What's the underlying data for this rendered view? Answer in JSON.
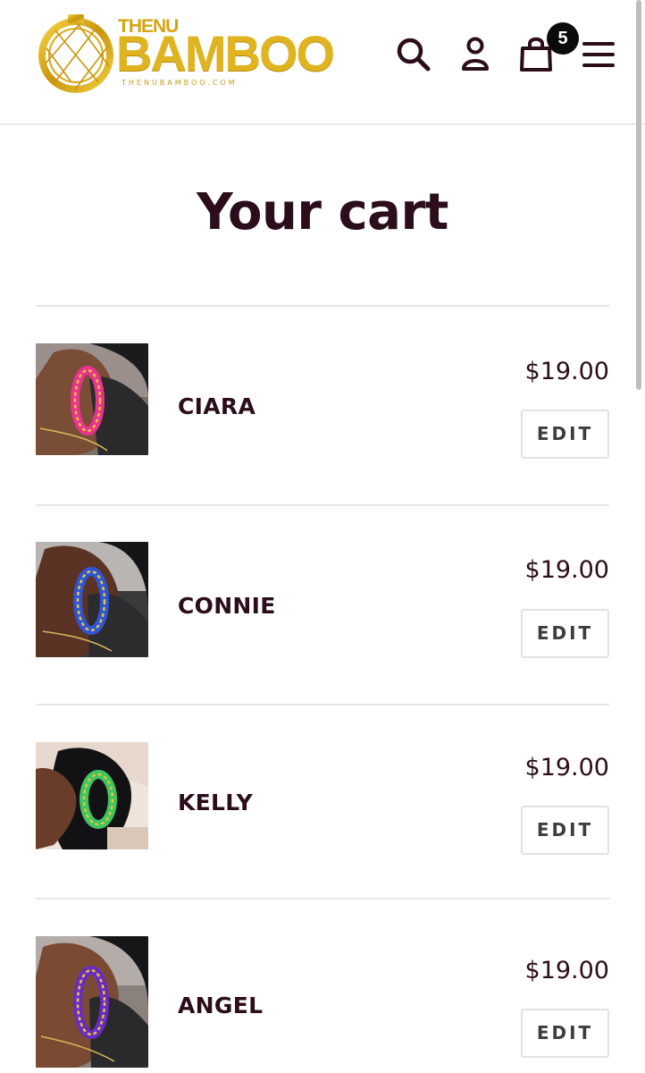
{
  "header": {
    "logo_top": "THENU",
    "logo_main": "BAMBOO",
    "logo_sub": "THENUBAMBOO.COM",
    "cart_count": "5",
    "icons": [
      "search-icon",
      "account-icon",
      "cart-bag-icon",
      "hamburger-menu-icon"
    ]
  },
  "page": {
    "title": "Your cart"
  },
  "cart": {
    "edit_label": "EDIT",
    "items": [
      {
        "name": "CIARA",
        "price": "$19.00",
        "hoop_color": "#e8338f"
      },
      {
        "name": "CONNIE",
        "price": "$19.00",
        "hoop_color": "#2f55d6"
      },
      {
        "name": "KELLY",
        "price": "$19.00",
        "hoop_color": "#3fc463"
      },
      {
        "name": "ANGEL",
        "price": "$19.00",
        "hoop_color": "#6a2bc2"
      }
    ]
  },
  "colors": {
    "text": "#2b0d1c",
    "gold": "#e0b41e",
    "badge": "#0b0b0b"
  }
}
